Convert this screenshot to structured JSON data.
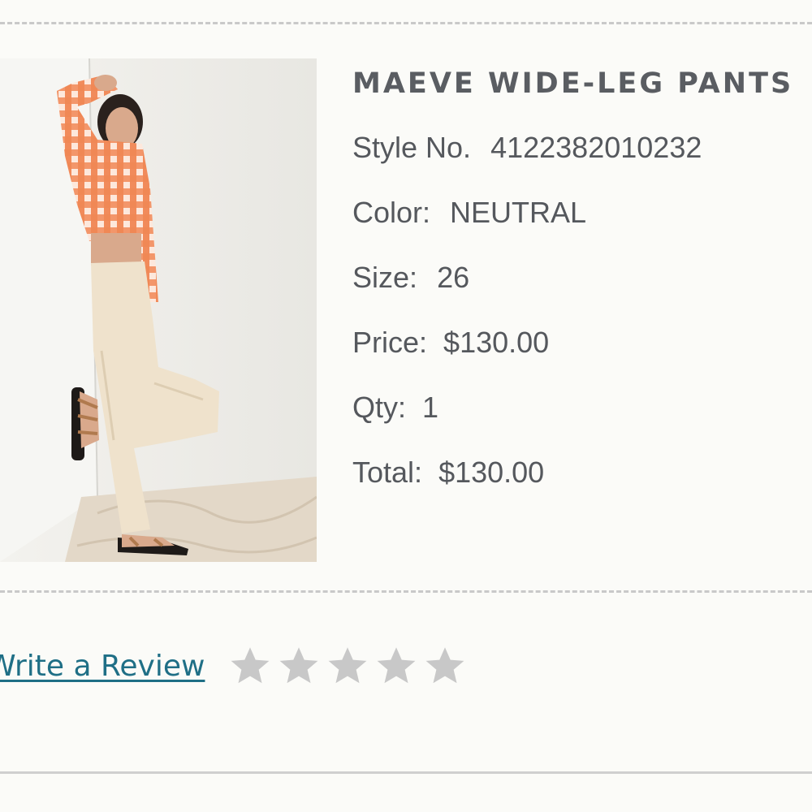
{
  "product": {
    "name": "MAEVE WIDE-LEG PANTS",
    "style_label": "Style No.",
    "style_value": "4122382010232",
    "color_label": "Color:",
    "color_value": "NEUTRAL",
    "size_label": "Size:",
    "size_value": "26",
    "price_label": "Price:",
    "price_value": "$130.00",
    "qty_label": "Qty:",
    "qty_value": "1",
    "total_label": "Total:",
    "total_value": "$130.00",
    "image_icon": "product-photo"
  },
  "review": {
    "link_text": "Write a Review",
    "rating": 0,
    "max_stars": 5,
    "star_icon": "star-outline-icon"
  },
  "colors": {
    "accent_link": "#1f6f86",
    "text": "#55585d",
    "star_empty": "#c8c8c8"
  }
}
